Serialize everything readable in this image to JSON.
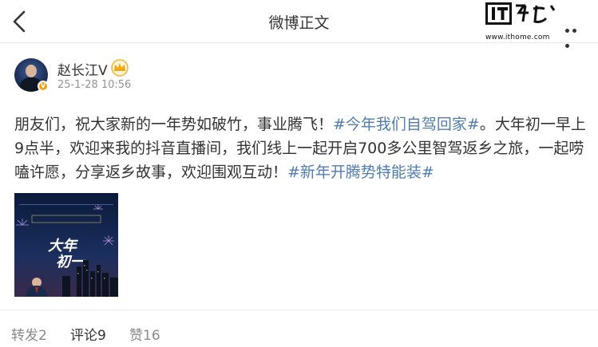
{
  "header": {
    "title": "微博正文",
    "watermark_logo": "IT之家",
    "watermark_url": "www.ithome.com"
  },
  "post": {
    "author_name": "赵长江V",
    "timestamp": "25-1-28 10:56",
    "text_1": "朋友们，祝大家新的一年势如破竹，事业腾飞！",
    "tag_1": "#今年我们自驾回家#",
    "text_2": "。大年初一早上9点半，欢迎来我的抖音直播间，我们线上一起开启700多公里智驾返乡之旅，一起唠嗑许愿，分享返乡故事，欢迎围观互动！",
    "tag_2": "#新年开腾势特能装#",
    "image_text": "大年初一"
  },
  "actions": {
    "repost": "转发2",
    "comment": "评论9",
    "like": "赞16"
  },
  "colors": {
    "tag": "#507daf",
    "verified_badge": "#f0a11a",
    "muted": "#939393"
  },
  "icons": [
    "back-arrow-icon",
    "more-dots-icon",
    "crown-icon",
    "verified-badge-icon"
  ]
}
